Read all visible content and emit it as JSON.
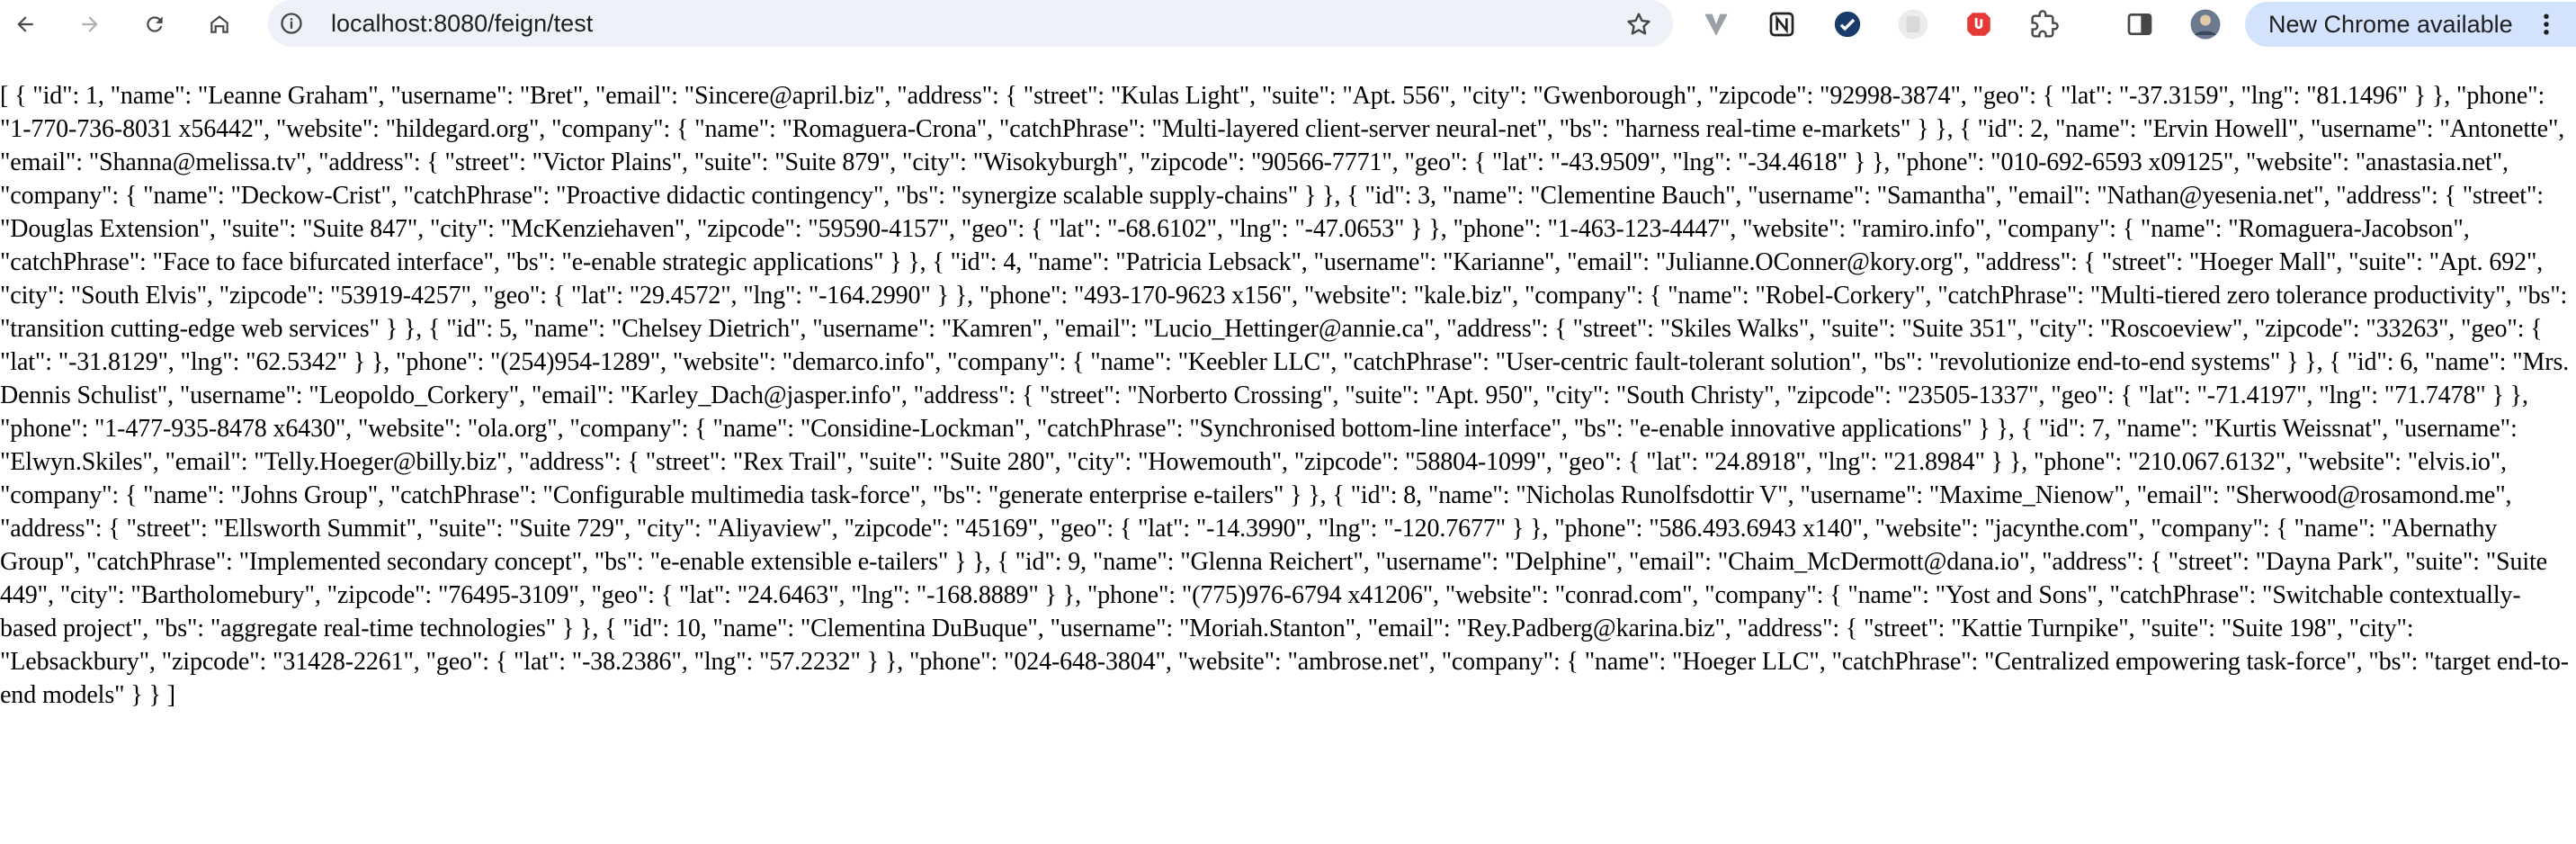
{
  "browser": {
    "url": "localhost:8080/feign/test",
    "update_label": "New Chrome available"
  },
  "icons": {
    "back": "arrow-left-icon",
    "forward": "arrow-right-icon",
    "reload": "reload-icon",
    "home": "home-icon",
    "site_info": "info-icon",
    "bookmark": "star-icon",
    "extensions": [
      "vuetify-icon",
      "notion-icon",
      "check-badge-icon",
      "profile-ext-icon",
      "shield-red-icon",
      "puzzle-icon",
      "side-panel-icon",
      "avatar"
    ],
    "menu": "kebab-menu-icon"
  },
  "colors": {
    "toolbar_bg": "#ffffff",
    "omnibox_bg": "#eef1f7",
    "update_pill_bg": "#d3e3fd",
    "text": "#000000"
  },
  "page": {
    "body_text": "[ { \"id\": 1, \"name\": \"Leanne Graham\", \"username\": \"Bret\", \"email\": \"Sincere@april.biz\", \"address\": { \"street\": \"Kulas Light\", \"suite\": \"Apt. 556\", \"city\": \"Gwenborough\", \"zipcode\": \"92998-3874\", \"geo\": { \"lat\": \"-37.3159\", \"lng\": \"81.1496\" } }, \"phone\": \"1-770-736-8031 x56442\", \"website\": \"hildegard.org\", \"company\": { \"name\": \"Romaguera-Crona\", \"catchPhrase\": \"Multi-layered client-server neural-net\", \"bs\": \"harness real-time e-markets\" } }, { \"id\": 2, \"name\": \"Ervin Howell\", \"username\": \"Antonette\", \"email\": \"Shanna@melissa.tv\", \"address\": { \"street\": \"Victor Plains\", \"suite\": \"Suite 879\", \"city\": \"Wisokyburgh\", \"zipcode\": \"90566-7771\", \"geo\": { \"lat\": \"-43.9509\", \"lng\": \"-34.4618\" } }, \"phone\": \"010-692-6593 x09125\", \"website\": \"anastasia.net\", \"company\": { \"name\": \"Deckow-Crist\", \"catchPhrase\": \"Proactive didactic contingency\", \"bs\": \"synergize scalable supply-chains\" } }, { \"id\": 3, \"name\": \"Clementine Bauch\", \"username\": \"Samantha\", \"email\": \"Nathan@yesenia.net\", \"address\": { \"street\": \"Douglas Extension\", \"suite\": \"Suite 847\", \"city\": \"McKenziehaven\", \"zipcode\": \"59590-4157\", \"geo\": { \"lat\": \"-68.6102\", \"lng\": \"-47.0653\" } }, \"phone\": \"1-463-123-4447\", \"website\": \"ramiro.info\", \"company\": { \"name\": \"Romaguera-Jacobson\", \"catchPhrase\": \"Face to face bifurcated interface\", \"bs\": \"e-enable strategic applications\" } }, { \"id\": 4, \"name\": \"Patricia Lebsack\", \"username\": \"Karianne\", \"email\": \"Julianne.OConner@kory.org\", \"address\": { \"street\": \"Hoeger Mall\", \"suite\": \"Apt. 692\", \"city\": \"South Elvis\", \"zipcode\": \"53919-4257\", \"geo\": { \"lat\": \"29.4572\", \"lng\": \"-164.2990\" } }, \"phone\": \"493-170-9623 x156\", \"website\": \"kale.biz\", \"company\": { \"name\": \"Robel-Corkery\", \"catchPhrase\": \"Multi-tiered zero tolerance productivity\", \"bs\": \"transition cutting-edge web services\" } }, { \"id\": 5, \"name\": \"Chelsey Dietrich\", \"username\": \"Kamren\", \"email\": \"Lucio_Hettinger@annie.ca\", \"address\": { \"street\": \"Skiles Walks\", \"suite\": \"Suite 351\", \"city\": \"Roscoeview\", \"zipcode\": \"33263\", \"geo\": { \"lat\": \"-31.8129\", \"lng\": \"62.5342\" } }, \"phone\": \"(254)954-1289\", \"website\": \"demarco.info\", \"company\": { \"name\": \"Keebler LLC\", \"catchPhrase\": \"User-centric fault-tolerant solution\", \"bs\": \"revolutionize end-to-end systems\" } }, { \"id\": 6, \"name\": \"Mrs. Dennis Schulist\", \"username\": \"Leopoldo_Corkery\", \"email\": \"Karley_Dach@jasper.info\", \"address\": { \"street\": \"Norberto Crossing\", \"suite\": \"Apt. 950\", \"city\": \"South Christy\", \"zipcode\": \"23505-1337\", \"geo\": { \"lat\": \"-71.4197\", \"lng\": \"71.7478\" } }, \"phone\": \"1-477-935-8478 x6430\", \"website\": \"ola.org\", \"company\": { \"name\": \"Considine-Lockman\", \"catchPhrase\": \"Synchronised bottom-line interface\", \"bs\": \"e-enable innovative applications\" } }, { \"id\": 7, \"name\": \"Kurtis Weissnat\", \"username\": \"Elwyn.Skiles\", \"email\": \"Telly.Hoeger@billy.biz\", \"address\": { \"street\": \"Rex Trail\", \"suite\": \"Suite 280\", \"city\": \"Howemouth\", \"zipcode\": \"58804-1099\", \"geo\": { \"lat\": \"24.8918\", \"lng\": \"21.8984\" } }, \"phone\": \"210.067.6132\", \"website\": \"elvis.io\", \"company\": { \"name\": \"Johns Group\", \"catchPhrase\": \"Configurable multimedia task-force\", \"bs\": \"generate enterprise e-tailers\" } }, { \"id\": 8, \"name\": \"Nicholas Runolfsdottir V\", \"username\": \"Maxime_Nienow\", \"email\": \"Sherwood@rosamond.me\", \"address\": { \"street\": \"Ellsworth Summit\", \"suite\": \"Suite 729\", \"city\": \"Aliyaview\", \"zipcode\": \"45169\", \"geo\": { \"lat\": \"-14.3990\", \"lng\": \"-120.7677\" } }, \"phone\": \"586.493.6943 x140\", \"website\": \"jacynthe.com\", \"company\": { \"name\": \"Abernathy Group\", \"catchPhrase\": \"Implemented secondary concept\", \"bs\": \"e-enable extensible e-tailers\" } }, { \"id\": 9, \"name\": \"Glenna Reichert\", \"username\": \"Delphine\", \"email\": \"Chaim_McDermott@dana.io\", \"address\": { \"street\": \"Dayna Park\", \"suite\": \"Suite 449\", \"city\": \"Bartholomebury\", \"zipcode\": \"76495-3109\", \"geo\": { \"lat\": \"24.6463\", \"lng\": \"-168.8889\" } }, \"phone\": \"(775)976-6794 x41206\", \"website\": \"conrad.com\", \"company\": { \"name\": \"Yost and Sons\", \"catchPhrase\": \"Switchable contextually-based project\", \"bs\": \"aggregate real-time technologies\" } }, { \"id\": 10, \"name\": \"Clementina DuBuque\", \"username\": \"Moriah.Stanton\", \"email\": \"Rey.Padberg@karina.biz\", \"address\": { \"street\": \"Kattie Turnpike\", \"suite\": \"Suite 198\", \"city\": \"Lebsackbury\", \"zipcode\": \"31428-2261\", \"geo\": { \"lat\": \"-38.2386\", \"lng\": \"57.2232\" } }, \"phone\": \"024-648-3804\", \"website\": \"ambrose.net\", \"company\": { \"name\": \"Hoeger LLC\", \"catchPhrase\": \"Centralized empowering task-force\", \"bs\": \"target end-to-end models\" } } ]"
  }
}
